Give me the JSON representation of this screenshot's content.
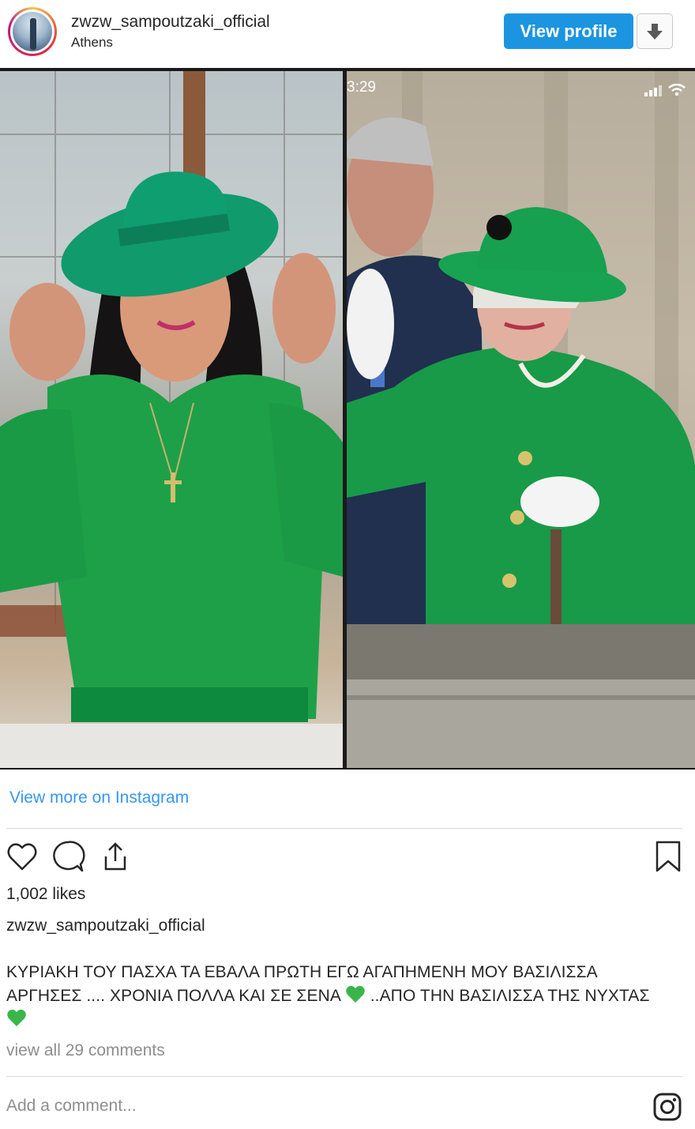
{
  "header": {
    "username": "zwzw_sampoutzaki_official",
    "location": "Athens",
    "view_profile_label": "View profile",
    "download_icon": "download-arrow-icon"
  },
  "photo": {
    "right_panel_status_time": "3:29",
    "status_icons": [
      "signal-icon",
      "wifi-icon"
    ]
  },
  "view_more_label": "View more on Instagram",
  "actions": {
    "icons": [
      "heart-icon",
      "comment-icon",
      "share-icon",
      "bookmark-icon"
    ]
  },
  "likes_text": "1,002 likes",
  "caption": {
    "owner": "zwzw_sampoutzaki_official",
    "line1": "ΚΥΡΙΑΚΗ ΤΟΥ ΠΑΣΧΑ ΤΑ ΕΒΑΛΑ ΠΡΩΤΗ ΕΓΩ ΑΓΑΠΗΜΕΝΗ ΜΟΥ ΒΑΣΙΛΙΣΣΑ",
    "line2_part1": "ΑΡΓΗΣΕΣ .... ΧΡΟΝΙΑ ΠΟΛΛΑ ΚΑΙ ΣΕ ΣΕΝΑ",
    "line2_part2": "..ΑΠΟ ΤΗΝ ΒΑΣΙΛΙΣΣΑ ΤΗΣ ΝΥΧΤΑΣ",
    "emoji": "green-heart"
  },
  "comments_link": "view all 29 comments",
  "comment_placeholder": "Add a comment...",
  "colors": {
    "primary_button": "#1b95e0",
    "link": "#3897f0",
    "muted_text": "#8e8e8e",
    "emoji_green": "#3ab54a"
  }
}
